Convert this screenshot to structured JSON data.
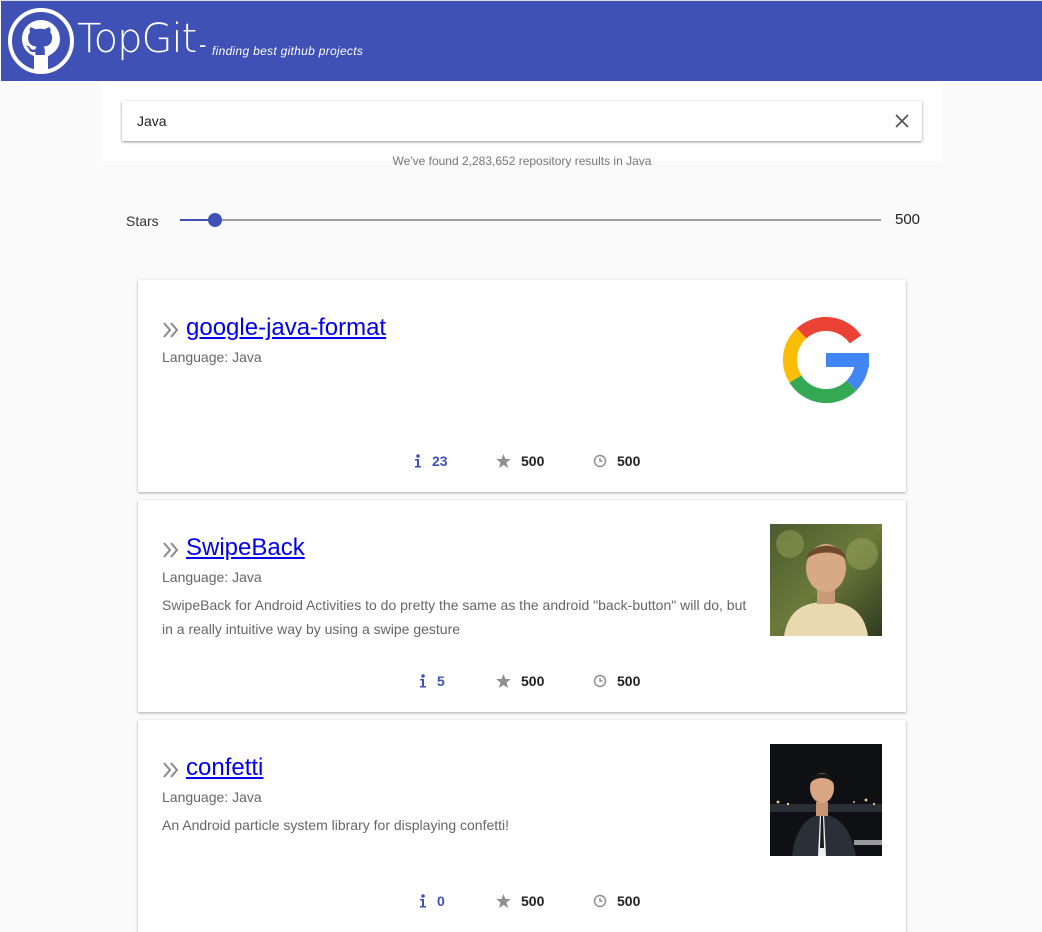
{
  "header": {
    "brand": "TopGit",
    "dash": "-",
    "tagline": "finding best github projects",
    "logo_icon": "github-octocat-icon",
    "background": "#3f51b5"
  },
  "search": {
    "value": "Java",
    "placeholder": "",
    "clear_icon": "close-icon",
    "result_text": "We've found 2,283,652 repository results in Java"
  },
  "filter": {
    "label": "Stars",
    "value": "500",
    "slider_fraction": 0.05
  },
  "repos": [
    {
      "name": "google-java-format",
      "language": "Language: Java",
      "description": "",
      "image": "google-logo",
      "issues": "23",
      "stars": "500",
      "watchers": "500"
    },
    {
      "name": "SwipeBack",
      "language": "Language: Java",
      "description": "SwipeBack for Android Activities to do pretty the same as the android \"back-button\" will do, but in a really intuitive way by using a swipe gesture",
      "image": "owner-avatar-photo",
      "issues": "5",
      "stars": "500",
      "watchers": "500"
    },
    {
      "name": "confetti",
      "language": "Language: Java",
      "description": "An Android particle system library for displaying confetti!",
      "image": "owner-avatar-photo",
      "issues": "0",
      "stars": "500",
      "watchers": "500"
    }
  ],
  "colors": {
    "primary": "#3f51b5",
    "link": "#0000ee"
  }
}
